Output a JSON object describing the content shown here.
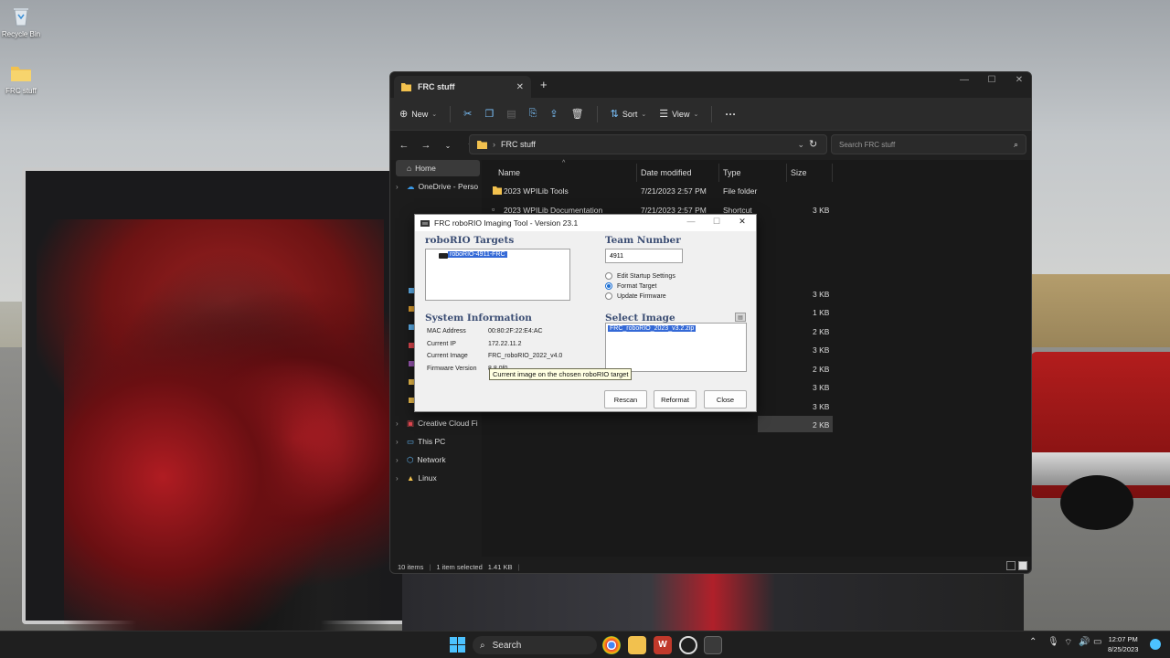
{
  "desktop": {
    "icons": [
      {
        "label": "Recycle Bin"
      },
      {
        "label": "FRC stuff"
      }
    ]
  },
  "explorer": {
    "tab_title": "FRC stuff",
    "toolbar": {
      "new_label": "New",
      "sort_label": "Sort",
      "view_label": "View",
      "more_label": "···"
    },
    "address": {
      "path": "FRC stuff",
      "search_placeholder": "Search FRC stuff"
    },
    "nav_pane": [
      {
        "label": "Home"
      },
      {
        "label": "OneDrive - Perso"
      },
      {
        "label": "Creative Cloud Fi"
      },
      {
        "label": "This PC"
      },
      {
        "label": "Network"
      },
      {
        "label": "Linux"
      }
    ],
    "columns": {
      "name": "Name",
      "date": "Date modified",
      "type": "Type",
      "size": "Size"
    },
    "rows": [
      {
        "name": "2023 WPILib Tools",
        "date": "7/21/2023 2:57 PM",
        "type": "File folder",
        "size": ""
      },
      {
        "name": "2023 WPILib Documentation",
        "date": "7/21/2023 2:57 PM",
        "type": "Shortcut",
        "size": "3 KB"
      }
    ],
    "hidden_sizes": [
      "3 KB",
      "1 KB",
      "2 KB",
      "3 KB",
      "2 KB",
      "3 KB",
      "3 KB",
      "2 KB"
    ],
    "status": {
      "items": "10 items",
      "selected": "1 item selected",
      "size": "1.41 KB"
    }
  },
  "dialog": {
    "title": "FRC roboRIO Imaging Tool - Version 23.1",
    "targets_heading": "roboRIO Targets",
    "target_item": "roboRIO-4911-FRC",
    "team_heading": "Team Number",
    "team_number": "4911",
    "options": [
      {
        "label": "Edit Startup Settings",
        "selected": false
      },
      {
        "label": "Format Target",
        "selected": true
      },
      {
        "label": "Update Firmware",
        "selected": false
      }
    ],
    "sysinfo_heading": "System Information",
    "sysinfo": [
      {
        "label": "MAC Address",
        "value": "00:80:2F:22:E4:AC"
      },
      {
        "label": "Current IP",
        "value": "172.22.11.2"
      },
      {
        "label": "Current Image",
        "value": "FRC_roboRIO_2022_v4.0"
      },
      {
        "label": "Firmware Version",
        "value": "8.8.0f0"
      }
    ],
    "image_heading": "Select Image",
    "image_item": "FRC_roboRIO_2023_v3.2.zip",
    "tooltip": "Current image on the chosen roboRIO target",
    "buttons": {
      "rescan": "Rescan",
      "reformat": "Reformat",
      "close": "Close"
    }
  },
  "taskbar": {
    "search_label": "Search",
    "time": "12:07 PM",
    "date": "8/25/2023"
  },
  "colors": {
    "explorer_bg": "#1c1c1c",
    "selection_blue": "#3469d6",
    "heading_blue": "#3b4d73",
    "tooltip_bg": "#ffffe1"
  }
}
